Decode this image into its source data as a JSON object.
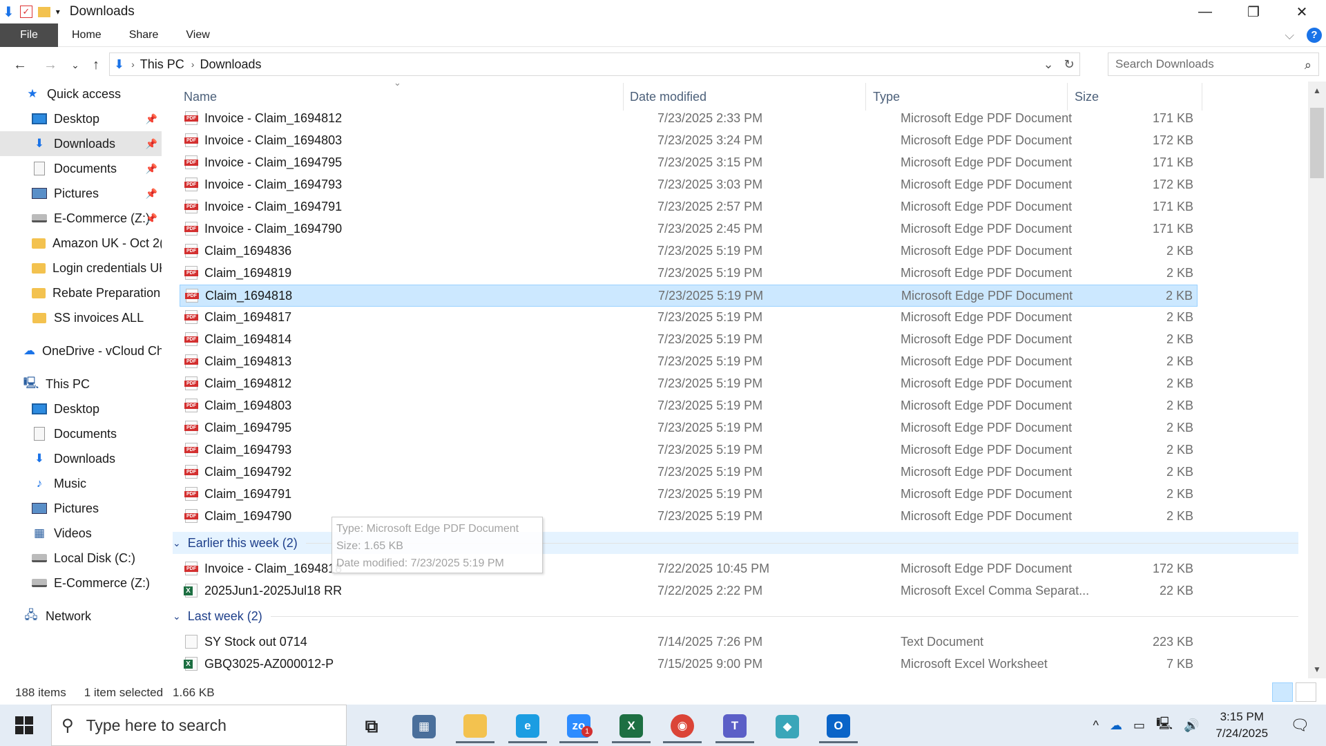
{
  "window": {
    "title": "Downloads",
    "minimize": "—",
    "restore": "❐",
    "close": "✕"
  },
  "ribbon": {
    "tabs": [
      "File",
      "Home",
      "Share",
      "View"
    ],
    "expand": "⌵",
    "help": "?"
  },
  "nav": {
    "back": "←",
    "forward": "→",
    "recent": "⌄",
    "up": "↑"
  },
  "address": {
    "crumbs": [
      "This PC",
      "Downloads"
    ],
    "sep": "›",
    "dropdown": "⌄",
    "refresh": "↻"
  },
  "search": {
    "placeholder": "Search Downloads",
    "icon": "⌕"
  },
  "sidebar": {
    "items": [
      {
        "label": "Quick access",
        "icon": "star-icon",
        "glyph": "★"
      },
      {
        "label": "Desktop",
        "icon": "desktop-icon",
        "pinned": true
      },
      {
        "label": "Downloads",
        "icon": "downloads-icon",
        "glyph": "⬇",
        "pinned": true,
        "selected": true
      },
      {
        "label": "Documents",
        "icon": "documents-icon",
        "pinned": true
      },
      {
        "label": "Pictures",
        "icon": "pictures-icon",
        "pinned": true
      },
      {
        "label": "E-Commerce (Z:)",
        "icon": "drive-icon",
        "pinned": true
      },
      {
        "label": "Amazon UK - Oct 2(",
        "icon": "folder-icon"
      },
      {
        "label": "Login credentials UK",
        "icon": "folder-icon"
      },
      {
        "label": "Rebate Preparation I",
        "icon": "folder-icon"
      },
      {
        "label": "SS invoices ALL",
        "icon": "folder-icon"
      },
      {
        "label": "OneDrive - vCloud Ch",
        "icon": "onedrive-icon",
        "glyph": "☁"
      },
      {
        "label": "This PC",
        "icon": "this-pc-icon",
        "glyph": "🖳"
      },
      {
        "label": "Desktop",
        "icon": "desktop-icon"
      },
      {
        "label": "Documents",
        "icon": "documents-icon"
      },
      {
        "label": "Downloads",
        "icon": "downloads-icon",
        "glyph": "⬇"
      },
      {
        "label": "Music",
        "icon": "music-icon",
        "glyph": "♪"
      },
      {
        "label": "Pictures",
        "icon": "pictures-icon"
      },
      {
        "label": "Videos",
        "icon": "videos-icon",
        "glyph": "▦"
      },
      {
        "label": "Local Disk (C:)",
        "icon": "drive-icon"
      },
      {
        "label": "E-Commerce (Z:)",
        "icon": "drive-icon"
      },
      {
        "label": "Network",
        "icon": "network-icon",
        "glyph": "🖧"
      }
    ],
    "pin_glyph": "📌"
  },
  "columns": {
    "sort_arrow": "⌄",
    "name": "Name",
    "date": "Date modified",
    "type": "Type",
    "size": "Size"
  },
  "files_today": [
    {
      "name": "Invoice - Claim_1694812",
      "date": "7/23/2025 2:33 PM",
      "type": "Microsoft Edge PDF Document",
      "size": "171 KB",
      "kind": "pdf"
    },
    {
      "name": "Invoice - Claim_1694803",
      "date": "7/23/2025 3:24 PM",
      "type": "Microsoft Edge PDF Document",
      "size": "172 KB",
      "kind": "pdf"
    },
    {
      "name": "Invoice - Claim_1694795",
      "date": "7/23/2025 3:15 PM",
      "type": "Microsoft Edge PDF Document",
      "size": "171 KB",
      "kind": "pdf"
    },
    {
      "name": "Invoice - Claim_1694793",
      "date": "7/23/2025 3:03 PM",
      "type": "Microsoft Edge PDF Document",
      "size": "172 KB",
      "kind": "pdf"
    },
    {
      "name": "Invoice - Claim_1694791",
      "date": "7/23/2025 2:57 PM",
      "type": "Microsoft Edge PDF Document",
      "size": "171 KB",
      "kind": "pdf"
    },
    {
      "name": "Invoice - Claim_1694790",
      "date": "7/23/2025 2:45 PM",
      "type": "Microsoft Edge PDF Document",
      "size": "171 KB",
      "kind": "pdf"
    },
    {
      "name": "Claim_1694836",
      "date": "7/23/2025 5:19 PM",
      "type": "Microsoft Edge PDF Document",
      "size": "2 KB",
      "kind": "pdf"
    },
    {
      "name": "Claim_1694819",
      "date": "7/23/2025 5:19 PM",
      "type": "Microsoft Edge PDF Document",
      "size": "2 KB",
      "kind": "pdf"
    },
    {
      "name": "Claim_1694818",
      "date": "7/23/2025 5:19 PM",
      "type": "Microsoft Edge PDF Document",
      "size": "2 KB",
      "kind": "pdf",
      "selected": true
    },
    {
      "name": "Claim_1694817",
      "date": "7/23/2025 5:19 PM",
      "type": "Microsoft Edge PDF Document",
      "size": "2 KB",
      "kind": "pdf"
    },
    {
      "name": "Claim_1694814",
      "date": "7/23/2025 5:19 PM",
      "type": "Microsoft Edge PDF Document",
      "size": "2 KB",
      "kind": "pdf"
    },
    {
      "name": "Claim_1694813",
      "date": "7/23/2025 5:19 PM",
      "type": "Microsoft Edge PDF Document",
      "size": "2 KB",
      "kind": "pdf"
    },
    {
      "name": "Claim_1694812",
      "date": "7/23/2025 5:19 PM",
      "type": "Microsoft Edge PDF Document",
      "size": "2 KB",
      "kind": "pdf"
    },
    {
      "name": "Claim_1694803",
      "date": "7/23/2025 5:19 PM",
      "type": "Microsoft Edge PDF Document",
      "size": "2 KB",
      "kind": "pdf"
    },
    {
      "name": "Claim_1694795",
      "date": "7/23/2025 5:19 PM",
      "type": "Microsoft Edge PDF Document",
      "size": "2 KB",
      "kind": "pdf"
    },
    {
      "name": "Claim_1694793",
      "date": "7/23/2025 5:19 PM",
      "type": "Microsoft Edge PDF Document",
      "size": "2 KB",
      "kind": "pdf"
    },
    {
      "name": "Claim_1694792",
      "date": "7/23/2025 5:19 PM",
      "type": "Microsoft Edge PDF Document",
      "size": "2 KB",
      "kind": "pdf"
    },
    {
      "name": "Claim_1694791",
      "date": "7/23/2025 5:19 PM",
      "type": "Microsoft Edge PDF Document",
      "size": "2 KB",
      "kind": "pdf"
    },
    {
      "name": "Claim_1694790",
      "date": "7/23/2025 5:19 PM",
      "type": "Microsoft Edge PDF Document",
      "size": "2 KB",
      "kind": "pdf"
    }
  ],
  "group_week": {
    "label": "Earlier this week (2)",
    "chevron": "⌄"
  },
  "files_week": [
    {
      "name": "Invoice - Claim_1694818",
      "date": "7/22/2025 10:45 PM",
      "type": "Microsoft Edge PDF Document",
      "size": "172 KB",
      "kind": "pdf"
    },
    {
      "name": "2025Jun1-2025Jul18 RR",
      "date": "7/22/2025 2:22 PM",
      "type": "Microsoft Excel Comma Separat...",
      "size": "22 KB",
      "kind": "xls"
    }
  ],
  "group_last": {
    "label": "Last week (2)",
    "chevron": "⌄"
  },
  "files_last": [
    {
      "name": "SY Stock out 0714",
      "date": "7/14/2025 7:26 PM",
      "type": "Text Document",
      "size": "223 KB",
      "kind": "txt"
    },
    {
      "name": "GBQ3025-AZ000012-P",
      "date": "7/15/2025 9:00 PM",
      "type": "Microsoft Excel Worksheet",
      "size": "7 KB",
      "kind": "xls"
    }
  ],
  "tooltip": {
    "type": "Type: Microsoft Edge PDF Document",
    "size": "Size: 1.65 KB",
    "date": "Date modified: 7/23/2025 5:19 PM"
  },
  "status": {
    "count": "188 items",
    "selected": "1 item selected",
    "size": "1.66 KB"
  },
  "scroll": {
    "up": "▲",
    "down": "▼"
  },
  "taskbar": {
    "search_placeholder": "Type here to search",
    "search_icon": "⚲",
    "apps": [
      {
        "name": "task-view",
        "glyph": "⧉",
        "color": "transparent"
      },
      {
        "name": "calculator",
        "glyph": "▦",
        "color": "#4a6f9b"
      },
      {
        "name": "file-explorer",
        "glyph": "",
        "color": "#f3c24f"
      },
      {
        "name": "edge",
        "glyph": "e",
        "color": "#1b9de2"
      },
      {
        "name": "zoom",
        "glyph": "zo",
        "color": "#2d8cff"
      },
      {
        "name": "excel",
        "glyph": "X",
        "color": "#1d6f42"
      },
      {
        "name": "chrome",
        "glyph": "◉",
        "color": "#db4437"
      },
      {
        "name": "teams",
        "glyph": "T",
        "color": "#5b5fc7"
      },
      {
        "name": "app-diamond",
        "glyph": "◆",
        "color": "#3aa6b9"
      },
      {
        "name": "outlook",
        "glyph": "O",
        "color": "#0a64c8"
      }
    ],
    "badge": "1",
    "tray": {
      "chevron": "^",
      "cloud": "☁",
      "battery": "▭",
      "network": "🖳",
      "volume": "🔊",
      "notify": "🗨"
    },
    "time": "3:15 PM",
    "date": "7/24/2025"
  }
}
